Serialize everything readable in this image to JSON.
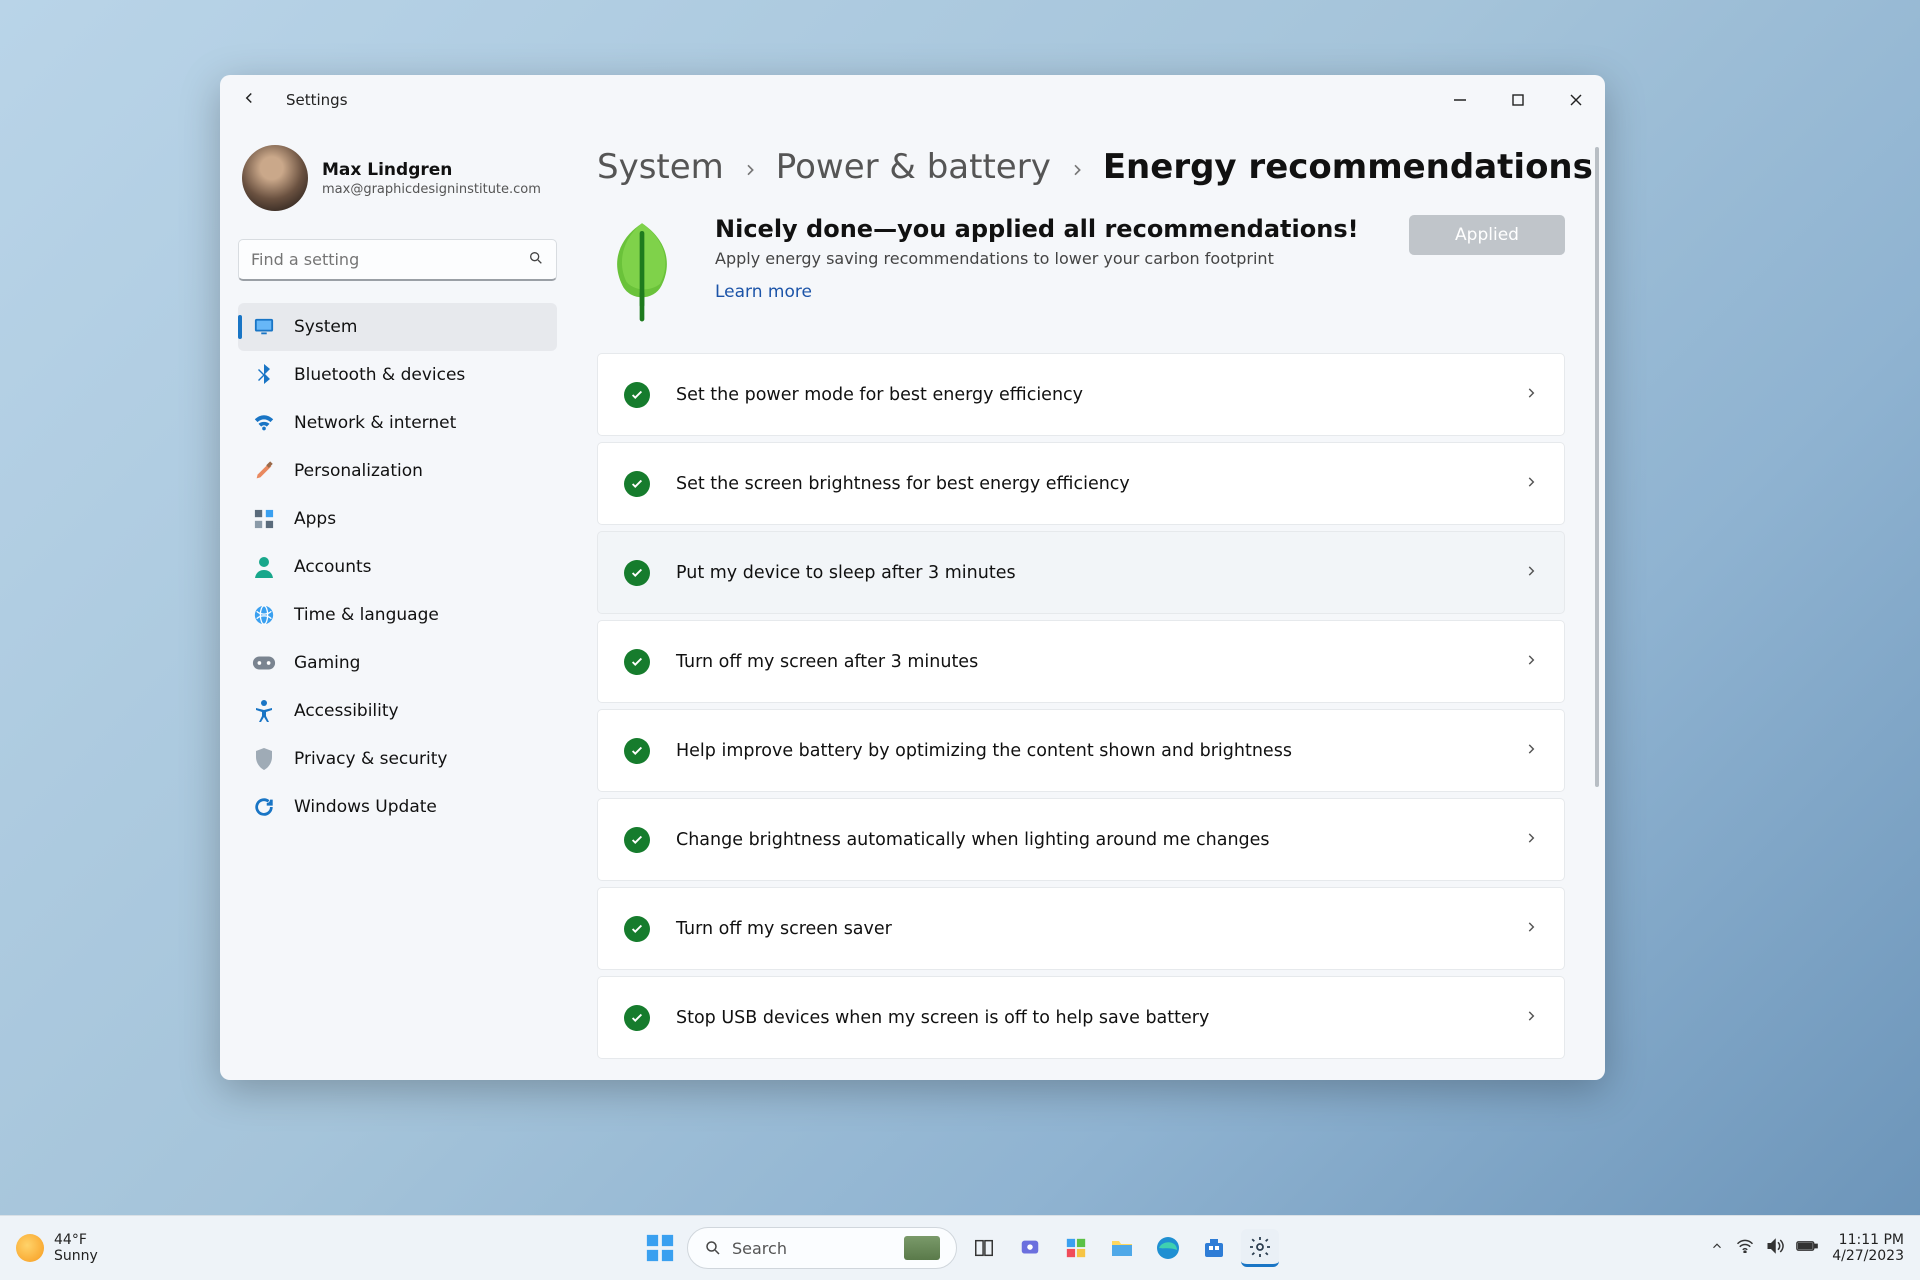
{
  "window": {
    "title": "Settings"
  },
  "profile": {
    "name": "Max Lindgren",
    "email": "max@graphicdesigninstitute.com"
  },
  "search": {
    "placeholder": "Find a setting"
  },
  "sidebar_items": [
    {
      "label": "System",
      "selected": true,
      "icon": "monitor"
    },
    {
      "label": "Bluetooth & devices",
      "selected": false,
      "icon": "bluetooth"
    },
    {
      "label": "Network & internet",
      "selected": false,
      "icon": "wifi"
    },
    {
      "label": "Personalization",
      "selected": false,
      "icon": "brush"
    },
    {
      "label": "Apps",
      "selected": false,
      "icon": "apps"
    },
    {
      "label": "Accounts",
      "selected": false,
      "icon": "person"
    },
    {
      "label": "Time & language",
      "selected": false,
      "icon": "globe"
    },
    {
      "label": "Gaming",
      "selected": false,
      "icon": "gamepad"
    },
    {
      "label": "Accessibility",
      "selected": false,
      "icon": "accessibility"
    },
    {
      "label": "Privacy & security",
      "selected": false,
      "icon": "shield"
    },
    {
      "label": "Windows Update",
      "selected": false,
      "icon": "update"
    }
  ],
  "breadcrumb": [
    {
      "label": "System",
      "current": false
    },
    {
      "label": "Power & battery",
      "current": false
    },
    {
      "label": "Energy recommendations",
      "current": true
    }
  ],
  "hero": {
    "title": "Nicely done—you applied all recommendations!",
    "subtitle": "Apply energy saving recommendations to lower your carbon footprint",
    "learn_more": "Learn more",
    "button": "Applied"
  },
  "recommendations": [
    "Set the power mode for best energy efficiency",
    "Set the screen brightness for best energy efficiency",
    "Put my device to sleep after 3 minutes",
    "Turn off my screen after 3 minutes",
    "Help improve battery by optimizing the content shown and brightness",
    "Change brightness automatically when lighting around me changes",
    "Turn off my screen saver",
    "Stop USB devices when my screen is off to help save battery"
  ],
  "taskbar": {
    "weather_temp": "44°F",
    "weather_desc": "Sunny",
    "search_label": "Search",
    "time": "11:11 PM",
    "date": "4/27/2023"
  }
}
